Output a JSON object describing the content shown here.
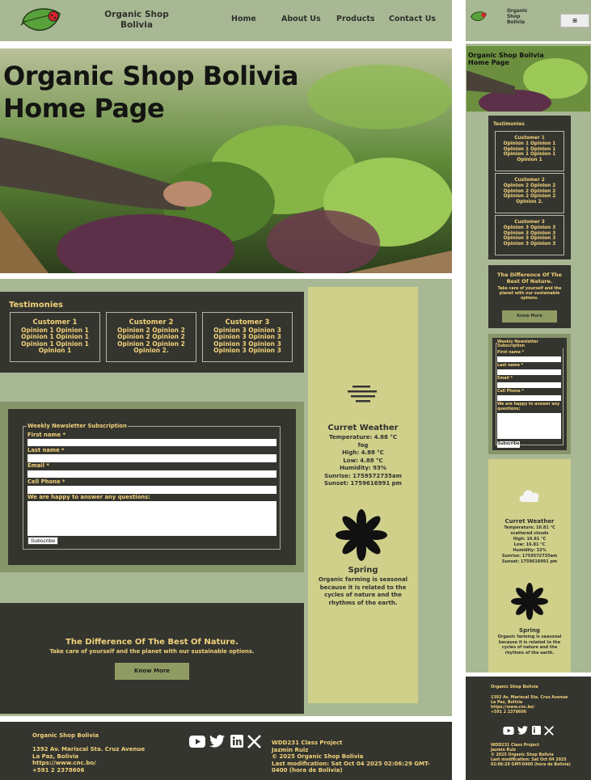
{
  "header": {
    "brand": "Organic Shop Bolivia",
    "nav": [
      "Home",
      "About Us",
      "Products",
      "Contact Us"
    ],
    "mobile_brand_lines": [
      "Organic",
      "Shop",
      "Bolivia"
    ],
    "menu_icon": "hamburger-icon"
  },
  "hero": {
    "title_line1": "Organic Shop Bolivia",
    "title_line2": "Home Page",
    "mobile_title": "Organic Shop Bolivia Home Page"
  },
  "testimonies": {
    "title": "Testimonies",
    "cards": [
      {
        "name": "Customer 1",
        "lines": [
          "Opinion 1 Opinion 1",
          "Opinion 1 Opinion 1",
          "Opinion 1 Opinion 1",
          "Opinion 1"
        ]
      },
      {
        "name": "Customer 2",
        "lines": [
          "Opinion 2 Opinion 2",
          "Opinion 2 Opinion 2",
          "Opinion 2 Opinion 2",
          "Opinion 2."
        ]
      },
      {
        "name": "Customer 3",
        "lines": [
          "Opinion 3 Opinion 3",
          "Opinion 3 Opinion 3",
          "Opinion 3 Opinion 3",
          "Opinion 3 Opinion 3"
        ]
      }
    ]
  },
  "newsletter": {
    "legend": "Weekly Newsletter Subscription",
    "first_name": "First name *",
    "last_name": "Last name *",
    "email": "Email *",
    "phone": "Cell Phone *",
    "questions": "We are happy to answer any questions:",
    "submit": "Subscribe"
  },
  "difference": {
    "title": "The Difference Of The Best Of Nature.",
    "subtitle": "Take care of yourself and the planet with our sustainable options.",
    "button": "Know More"
  },
  "weather": {
    "icon": "fog-icon",
    "title": "Curret Weather",
    "temperature": "Temperature: 4.88 °C",
    "condition": "fog",
    "high": "High: 4.88 °C",
    "low": "Low: 4.88 °C",
    "humidity": "Humidity: 93%",
    "sunrise": "Sunrise: 1759572735am",
    "sunset": "Sunset: 1759616991 pm"
  },
  "mobile_weather": {
    "icon": "cloud-icon",
    "title": "Curret Weather",
    "temperature": "Temperature: 16.81 °C",
    "condition": "scattered clouds",
    "high": "High: 16.81 °C",
    "low": "Low: 16.81 °C",
    "humidity": "Humidity: 32%",
    "sunrise": "Sunrise: 1759572735am",
    "sunset": "Sunset: 1759616991 pm"
  },
  "season": {
    "icon": "flower-icon",
    "title": "Spring",
    "text": "Organic farming is seasonal because it is related to the cycles of nature and the rhythms of the earth."
  },
  "footer": {
    "name": "Organic Shop Bolivia",
    "address1": "1392 Av. Mariscal Sta. Cruz Avenue",
    "address2": "La Paz, Bolivia",
    "url": "https://www.cnc.bo/",
    "phone": "+591 2 2378606",
    "project": "WDD231 Class Project",
    "author": "Jazmin Ruiz",
    "copyright": "©       2025 Organic Shop Bolivia",
    "modified": "Last modification:       Sat Oct 04 2025 02:06:29 GMT-0400 (hora de Bolivia)",
    "social": [
      "youtube-icon",
      "twitter-icon",
      "linkedin-icon",
      "x-icon"
    ]
  },
  "colors": {
    "sage": "#a9b894",
    "dark": "#34352f",
    "cream": "#d0d08b",
    "gold": "#f2d27b",
    "button": "#8f9b63"
  }
}
